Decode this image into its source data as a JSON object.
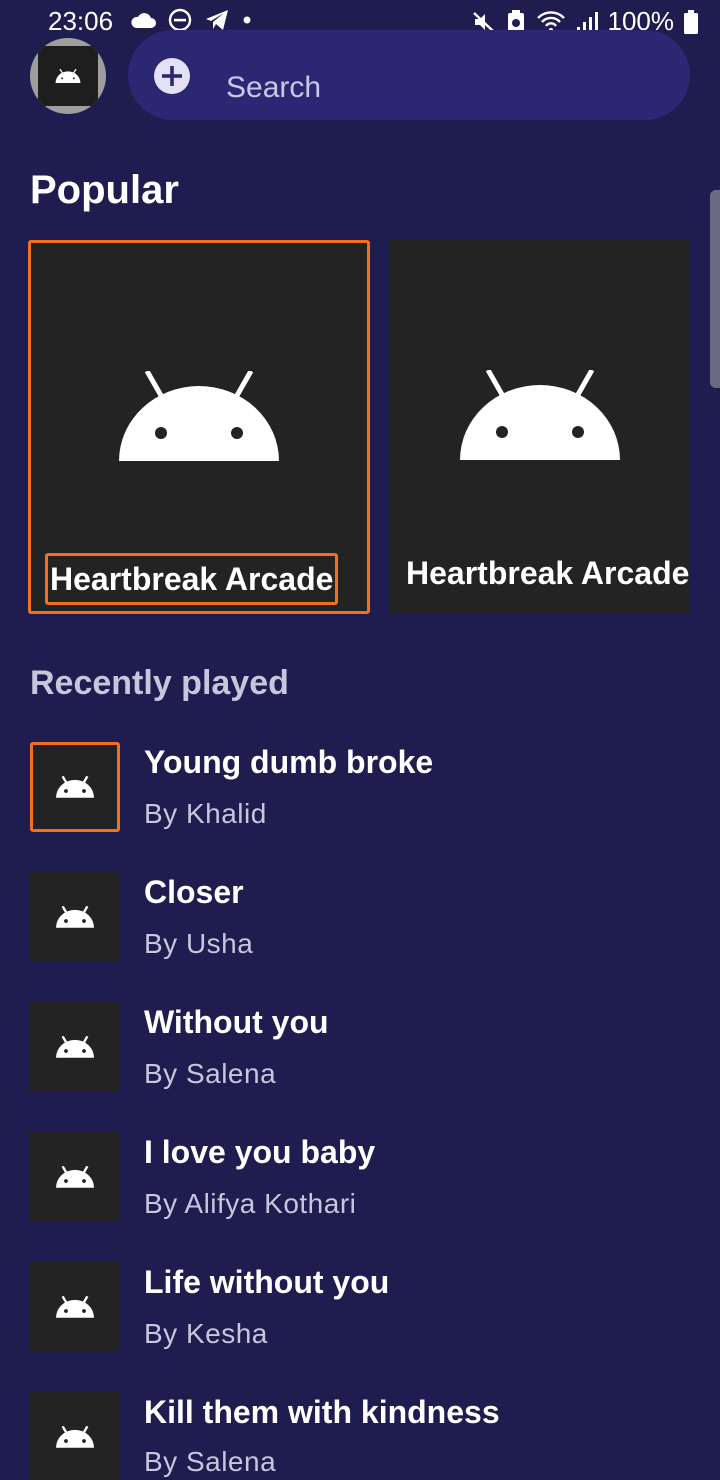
{
  "status_bar": {
    "time": "23:06",
    "battery": "100%"
  },
  "header": {
    "search_placeholder": "Search"
  },
  "popular": {
    "title": "Popular",
    "cards": [
      {
        "title": "Heartbreak Arcade"
      },
      {
        "title": "Heartbreak Arcade"
      }
    ]
  },
  "recent": {
    "title": "Recently played",
    "items": [
      {
        "title": "Young dumb broke",
        "artist": "By Khalid"
      },
      {
        "title": "Closer",
        "artist": "By Usha"
      },
      {
        "title": "Without you",
        "artist": "By Salena"
      },
      {
        "title": "I love you baby",
        "artist": "By Alifya Kothari"
      },
      {
        "title": "Life without you",
        "artist": "By Kesha"
      },
      {
        "title": "Kill them with kindness",
        "artist": "By Salena"
      }
    ]
  },
  "colors": {
    "background": "#1f1c4f",
    "search_bg": "#2c2773",
    "focus_accent": "#f37021",
    "card_bg": "#232323"
  },
  "icons": {
    "album_art": "android-icon",
    "search_action": "add-circle-icon"
  }
}
